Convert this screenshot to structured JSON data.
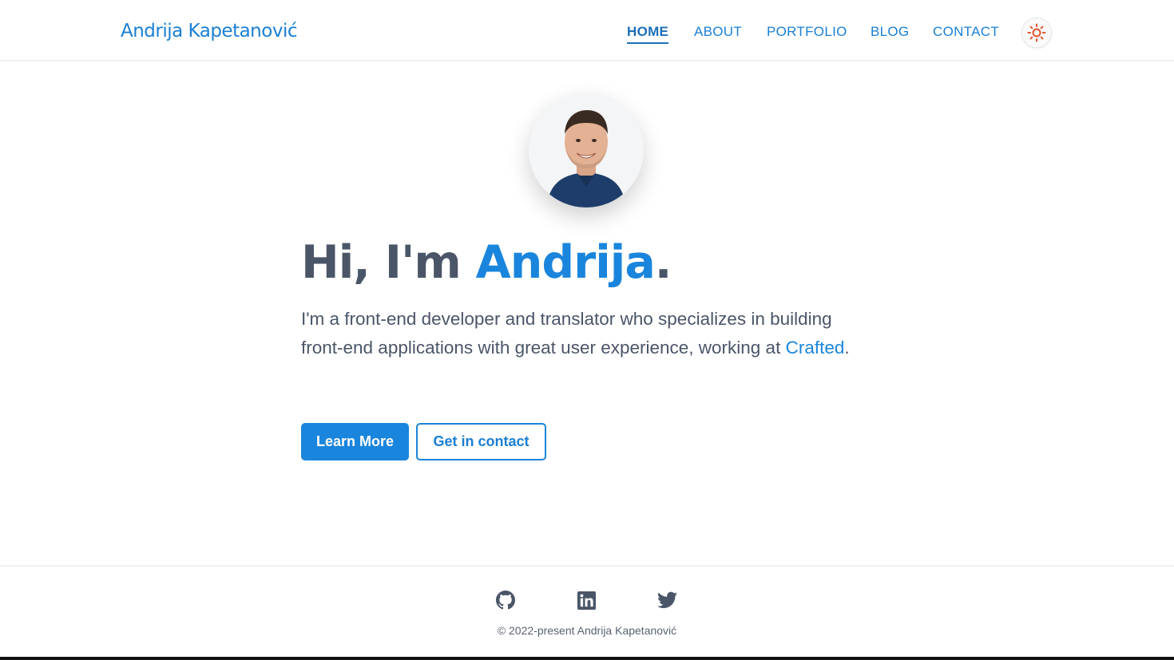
{
  "header": {
    "brand": "Andrija Kapetanović",
    "nav": [
      {
        "label": "HOME",
        "active": true
      },
      {
        "label": "ABOUT",
        "active": false
      },
      {
        "label": "PORTFOLIO",
        "active": false
      },
      {
        "label": "BLOG",
        "active": false
      },
      {
        "label": "CONTACT",
        "active": false
      }
    ],
    "theme_toggle_icon": "sun-icon"
  },
  "hero": {
    "avatar_icon": "profile-photo",
    "greeting_prefix": "Hi, I'm ",
    "greeting_name": "Andrija",
    "greeting_suffix": ".",
    "intro_text": "I'm a front-end developer and translator who specializes in building front-end applications with great user experience, working at ",
    "intro_link": "Crafted",
    "intro_end": ".",
    "primary_button": "Learn More",
    "secondary_button": "Get in contact"
  },
  "footer": {
    "social": [
      {
        "icon": "github-icon"
      },
      {
        "icon": "linkedin-icon"
      },
      {
        "icon": "twitter-icon"
      }
    ],
    "copyright": "© 2022-present Andrija Kapetanović"
  },
  "colors": {
    "accent": "#1a85dc",
    "text": "#4a5568",
    "sun": "#e0522a"
  }
}
